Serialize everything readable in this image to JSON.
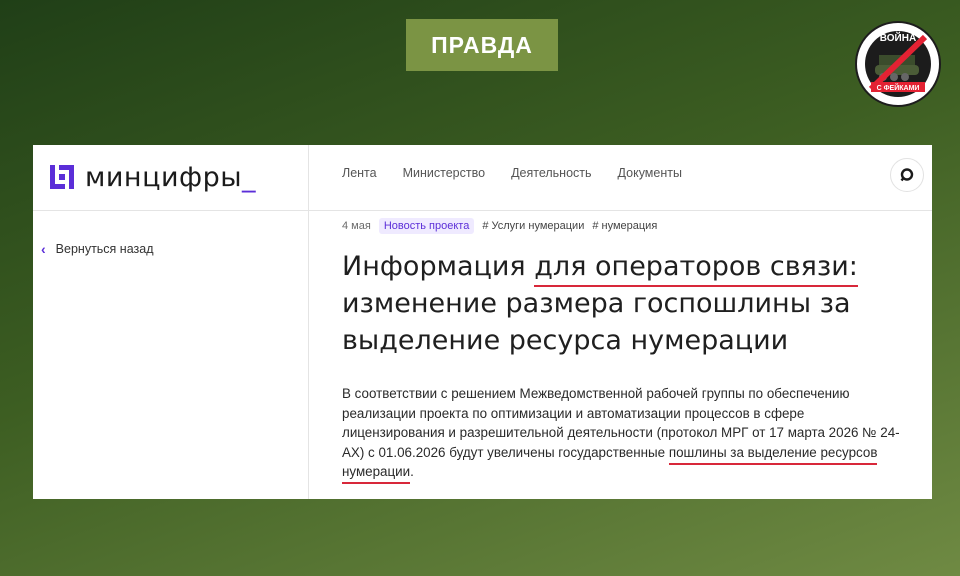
{
  "verdict": {
    "label": "ПРАВДА"
  },
  "badge": {
    "top_text": "ВОЙНА",
    "bottom_text": "С ФЕЙКАМИ"
  },
  "site": {
    "brand": "минцифры",
    "brand_cursor": "_",
    "nav": [
      "Лента",
      "Министерство",
      "Деятельность",
      "Документы"
    ],
    "back_label": "Вернуться назад"
  },
  "article": {
    "date": "4 мая",
    "badge": "Новость проекта",
    "tags": [
      "# Услуги нумерации",
      "# нумерация"
    ],
    "headline": {
      "part1": "Информация ",
      "underlined": "для операторов связи:",
      "part2": " изменение размера госпошлины за выделение ресурса нумерации"
    },
    "body": {
      "part1": "В соответствии с решением Межведомственной рабочей группы по обеспечению реализации проекта по оптимизации и автоматизации процессов в сфере лицензирования и разрешительной деятельности (протокол МРГ от 17 марта 2026 № 24-АХ) с 01.06.2026 будут увеличены государственные ",
      "underlined": "пошлины за выделение ресурсов нумерации",
      "end": "."
    }
  },
  "colors": {
    "accent": "#5b2ed8",
    "underline": "#d8283a",
    "verdict_bg": "#7b9444"
  }
}
